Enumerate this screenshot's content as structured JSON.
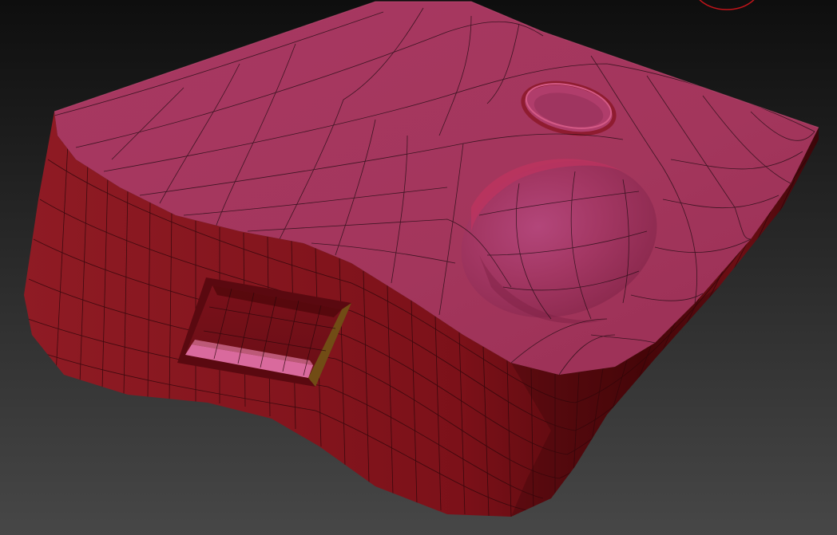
{
  "viewport": {
    "background_top": "#0e0e0e",
    "background_bottom": "#474747"
  },
  "model": {
    "kind": "subdivided box with dent, ring and rectangular inset",
    "top_color": "#a3365c",
    "side_color": "#8a1a22",
    "side_dark_color": "#3a0508",
    "wire_color": "#1c0a10",
    "inset_highlight_color": "#d96a9d"
  },
  "cursor": {
    "brush_ring_color": "#c0141a"
  }
}
